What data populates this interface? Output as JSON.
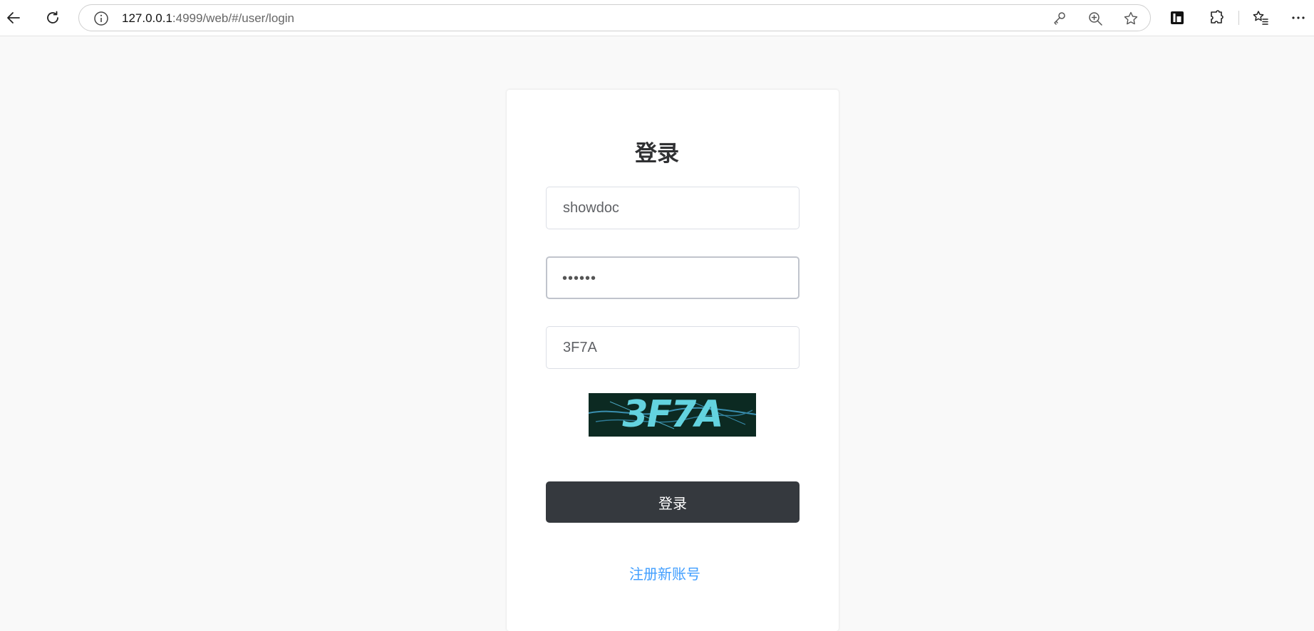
{
  "browser": {
    "url_host": "127.0.0.1",
    "url_path": ":4999/web/#/user/login"
  },
  "login": {
    "title": "登录",
    "username_value": "showdoc",
    "password_display": "••••••",
    "captcha_value": "3F7A",
    "captcha_image_text": "3F7A",
    "submit_label": "登录",
    "register_link": "注册新账号"
  },
  "colors": {
    "button_bg": "#35393e",
    "link": "#409eff",
    "captcha_bg": "#0c2a22",
    "captcha_text": "#63d3df"
  },
  "icons": [
    "back-icon",
    "refresh-icon",
    "info-icon",
    "key-icon",
    "zoom-icon",
    "favorite-star-icon",
    "reading-view-icon",
    "extensions-icon",
    "favorites-icon",
    "more-icon"
  ]
}
